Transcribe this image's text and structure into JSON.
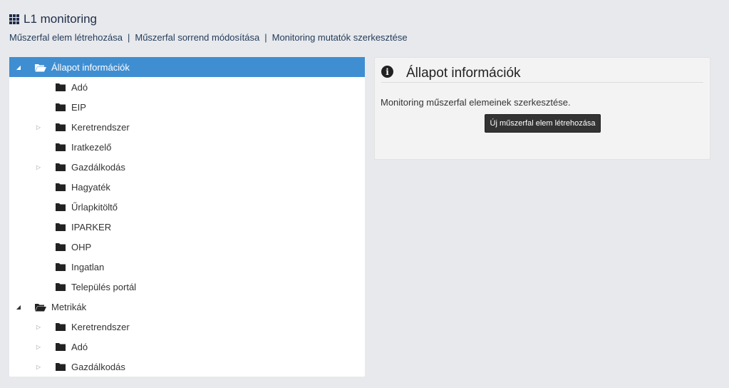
{
  "header": {
    "title": "L1 monitoring",
    "icon": "grid-icon"
  },
  "links": [
    "Műszerfal elem létrehozása",
    "Műszerfal sorrend módosítása",
    "Monitoring mutatók szerkesztése"
  ],
  "link_separator": "|",
  "tree": [
    {
      "label": "Állapot információk",
      "level": 0,
      "toggle": "open",
      "selected": true
    },
    {
      "label": "Adó",
      "level": 1,
      "toggle": "none"
    },
    {
      "label": "EIP",
      "level": 1,
      "toggle": "none"
    },
    {
      "label": "Keretrendszer",
      "level": 1,
      "toggle": "closed"
    },
    {
      "label": "Iratkezelő",
      "level": 1,
      "toggle": "none"
    },
    {
      "label": "Gazdálkodás",
      "level": 1,
      "toggle": "closed"
    },
    {
      "label": "Hagyaték",
      "level": 1,
      "toggle": "none"
    },
    {
      "label": "Űrlapkitöltő",
      "level": 1,
      "toggle": "none"
    },
    {
      "label": "IPARKER",
      "level": 1,
      "toggle": "none"
    },
    {
      "label": "OHP",
      "level": 1,
      "toggle": "none"
    },
    {
      "label": "Ingatlan",
      "level": 1,
      "toggle": "none"
    },
    {
      "label": "Település portál",
      "level": 1,
      "toggle": "none"
    },
    {
      "label": "Metrikák",
      "level": 0,
      "toggle": "open",
      "selected": false
    },
    {
      "label": "Keretrendszer",
      "level": 1,
      "toggle": "closed"
    },
    {
      "label": "Adó",
      "level": 1,
      "toggle": "closed"
    },
    {
      "label": "Gazdálkodás",
      "level": 1,
      "toggle": "closed"
    }
  ],
  "info": {
    "icon": "info-icon",
    "title": "Állapot információk",
    "text": "Monitoring műszerfal elemeinek szerkesztése.",
    "button_label": "Új műszerfal elem létrehozása"
  },
  "colors": {
    "selected_row": "#3f8ed2",
    "title": "#1f2d4a",
    "button": "#333333"
  }
}
